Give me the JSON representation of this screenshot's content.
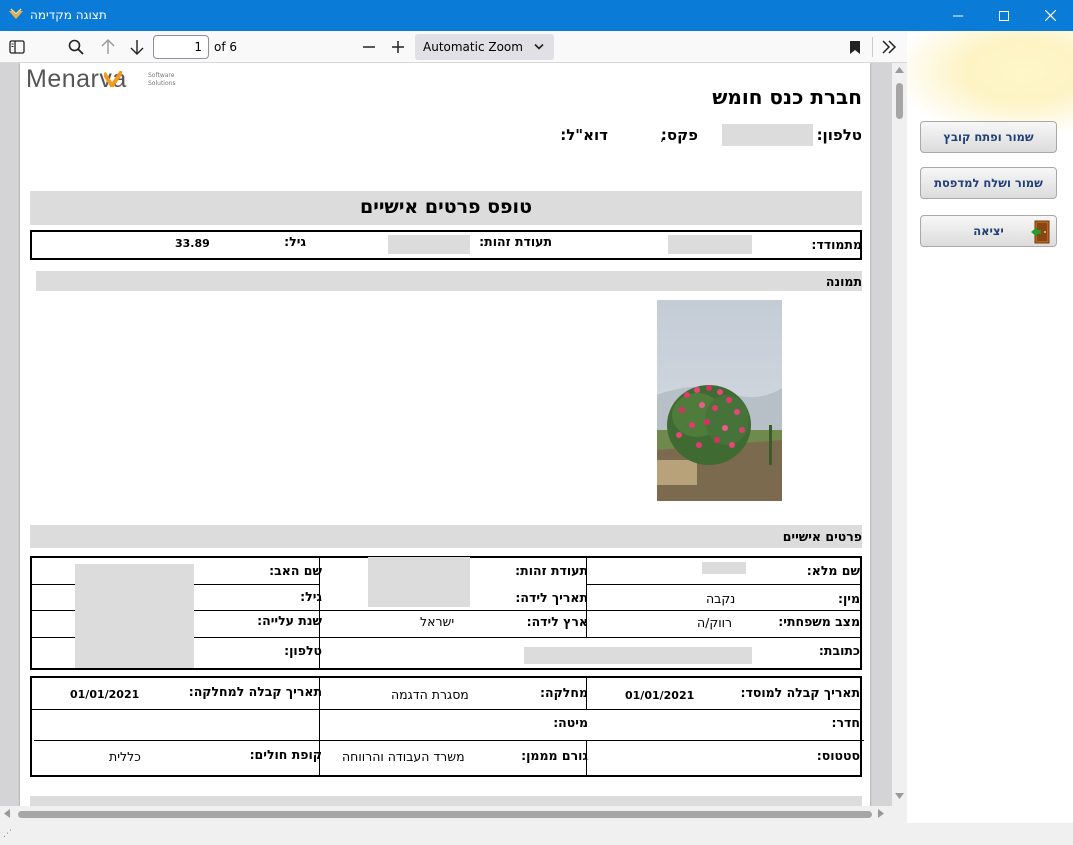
{
  "window": {
    "title": "תצוגה מקדימה"
  },
  "toolbar": {
    "page_number": "1",
    "page_of": "of 6",
    "zoom": "Automatic Zoom"
  },
  "side_panel": {
    "save_open_label": "שמור ופתח קובץ",
    "save_print_label": "שמור ושלח למדפסת",
    "exit_label": "יציאה"
  },
  "document": {
    "logo_text_main": "Menarva",
    "logo_sub1": "Software",
    "logo_sub2": "Solutions",
    "company_name": "חברת כנס חומש",
    "contact_phone_label": "טלפון:",
    "contact_fax_label": "פקס:",
    "contact_comma": ",",
    "contact_email_label": "דוא\"ל:",
    "form_title": "טופס פרטים אישיים",
    "summary": {
      "resident_label": "מתמודד:",
      "id_label": "תעודת זהות:",
      "age_label": "גיל:",
      "age_value": "33.89"
    },
    "photo_section_title": "תמונה",
    "personal_section_title": "פרטים אישיים",
    "personal": {
      "full_name_label": "שם מלא:",
      "id_label": "תעודת זהות:",
      "father_name_label": "שם האב:",
      "gender_label": "מין:",
      "gender_value": "נקבה",
      "birth_date_label": "תאריך לידה:",
      "age_label": "גיל:",
      "marital_label": "מצב משפחתי:",
      "marital_value": "רווק/ה",
      "birth_country_label": "ארץ לידה:",
      "birth_country_value": "ישראל",
      "aliyah_year_label": "שנת עלייה:",
      "address_label": "כתובת:",
      "phone_label": "טלפון:"
    },
    "admission": {
      "admission_date_label": "תאריך קבלה למוסד:",
      "admission_date_value": "01/01/2021",
      "department_label": "מחלקה:",
      "department_value": "מסגרת הדגמה",
      "dept_admission_label": "תאריך קבלה למחלקה:",
      "dept_admission_value": "01/01/2021",
      "room_label": "חדר:",
      "bed_label": "מיטה:",
      "status_label": "סטטוס:",
      "funder_label": "גורם מממן:",
      "funder_value": "משרד העבודה והרווחה",
      "hmo_label": "קופת חולים:",
      "hmo_value": "כללית"
    }
  },
  "colors": {
    "titlebar": "#0a7bd6",
    "section_bar": "#dcdcdc",
    "button_text": "#1f3f75",
    "logo_orange": "#f39a1e"
  }
}
